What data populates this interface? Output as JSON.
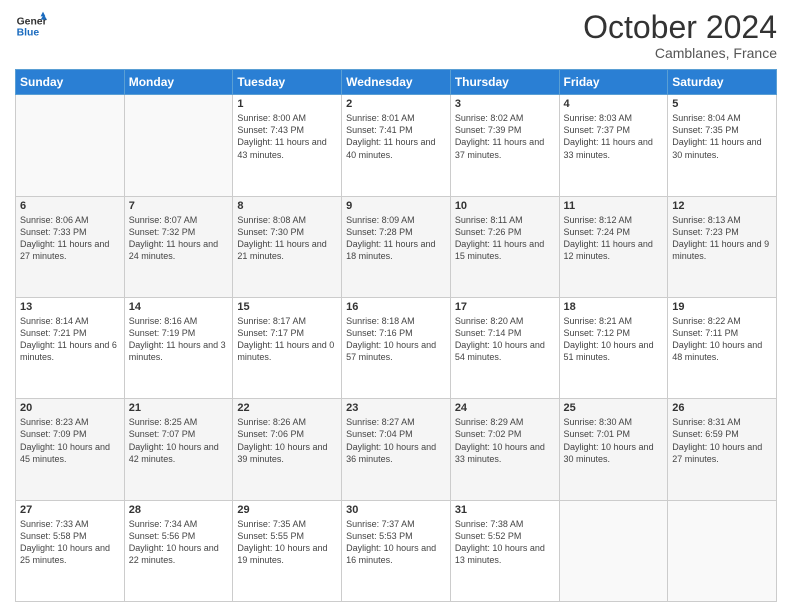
{
  "header": {
    "logo_line1": "General",
    "logo_line2": "Blue",
    "month": "October 2024",
    "location": "Camblanes, France"
  },
  "weekdays": [
    "Sunday",
    "Monday",
    "Tuesday",
    "Wednesday",
    "Thursday",
    "Friday",
    "Saturday"
  ],
  "weeks": [
    [
      {
        "day": "",
        "info": ""
      },
      {
        "day": "",
        "info": ""
      },
      {
        "day": "1",
        "info": "Sunrise: 8:00 AM\nSunset: 7:43 PM\nDaylight: 11 hours and 43 minutes."
      },
      {
        "day": "2",
        "info": "Sunrise: 8:01 AM\nSunset: 7:41 PM\nDaylight: 11 hours and 40 minutes."
      },
      {
        "day": "3",
        "info": "Sunrise: 8:02 AM\nSunset: 7:39 PM\nDaylight: 11 hours and 37 minutes."
      },
      {
        "day": "4",
        "info": "Sunrise: 8:03 AM\nSunset: 7:37 PM\nDaylight: 11 hours and 33 minutes."
      },
      {
        "day": "5",
        "info": "Sunrise: 8:04 AM\nSunset: 7:35 PM\nDaylight: 11 hours and 30 minutes."
      }
    ],
    [
      {
        "day": "6",
        "info": "Sunrise: 8:06 AM\nSunset: 7:33 PM\nDaylight: 11 hours and 27 minutes."
      },
      {
        "day": "7",
        "info": "Sunrise: 8:07 AM\nSunset: 7:32 PM\nDaylight: 11 hours and 24 minutes."
      },
      {
        "day": "8",
        "info": "Sunrise: 8:08 AM\nSunset: 7:30 PM\nDaylight: 11 hours and 21 minutes."
      },
      {
        "day": "9",
        "info": "Sunrise: 8:09 AM\nSunset: 7:28 PM\nDaylight: 11 hours and 18 minutes."
      },
      {
        "day": "10",
        "info": "Sunrise: 8:11 AM\nSunset: 7:26 PM\nDaylight: 11 hours and 15 minutes."
      },
      {
        "day": "11",
        "info": "Sunrise: 8:12 AM\nSunset: 7:24 PM\nDaylight: 11 hours and 12 minutes."
      },
      {
        "day": "12",
        "info": "Sunrise: 8:13 AM\nSunset: 7:23 PM\nDaylight: 11 hours and 9 minutes."
      }
    ],
    [
      {
        "day": "13",
        "info": "Sunrise: 8:14 AM\nSunset: 7:21 PM\nDaylight: 11 hours and 6 minutes."
      },
      {
        "day": "14",
        "info": "Sunrise: 8:16 AM\nSunset: 7:19 PM\nDaylight: 11 hours and 3 minutes."
      },
      {
        "day": "15",
        "info": "Sunrise: 8:17 AM\nSunset: 7:17 PM\nDaylight: 11 hours and 0 minutes."
      },
      {
        "day": "16",
        "info": "Sunrise: 8:18 AM\nSunset: 7:16 PM\nDaylight: 10 hours and 57 minutes."
      },
      {
        "day": "17",
        "info": "Sunrise: 8:20 AM\nSunset: 7:14 PM\nDaylight: 10 hours and 54 minutes."
      },
      {
        "day": "18",
        "info": "Sunrise: 8:21 AM\nSunset: 7:12 PM\nDaylight: 10 hours and 51 minutes."
      },
      {
        "day": "19",
        "info": "Sunrise: 8:22 AM\nSunset: 7:11 PM\nDaylight: 10 hours and 48 minutes."
      }
    ],
    [
      {
        "day": "20",
        "info": "Sunrise: 8:23 AM\nSunset: 7:09 PM\nDaylight: 10 hours and 45 minutes."
      },
      {
        "day": "21",
        "info": "Sunrise: 8:25 AM\nSunset: 7:07 PM\nDaylight: 10 hours and 42 minutes."
      },
      {
        "day": "22",
        "info": "Sunrise: 8:26 AM\nSunset: 7:06 PM\nDaylight: 10 hours and 39 minutes."
      },
      {
        "day": "23",
        "info": "Sunrise: 8:27 AM\nSunset: 7:04 PM\nDaylight: 10 hours and 36 minutes."
      },
      {
        "day": "24",
        "info": "Sunrise: 8:29 AM\nSunset: 7:02 PM\nDaylight: 10 hours and 33 minutes."
      },
      {
        "day": "25",
        "info": "Sunrise: 8:30 AM\nSunset: 7:01 PM\nDaylight: 10 hours and 30 minutes."
      },
      {
        "day": "26",
        "info": "Sunrise: 8:31 AM\nSunset: 6:59 PM\nDaylight: 10 hours and 27 minutes."
      }
    ],
    [
      {
        "day": "27",
        "info": "Sunrise: 7:33 AM\nSunset: 5:58 PM\nDaylight: 10 hours and 25 minutes."
      },
      {
        "day": "28",
        "info": "Sunrise: 7:34 AM\nSunset: 5:56 PM\nDaylight: 10 hours and 22 minutes."
      },
      {
        "day": "29",
        "info": "Sunrise: 7:35 AM\nSunset: 5:55 PM\nDaylight: 10 hours and 19 minutes."
      },
      {
        "day": "30",
        "info": "Sunrise: 7:37 AM\nSunset: 5:53 PM\nDaylight: 10 hours and 16 minutes."
      },
      {
        "day": "31",
        "info": "Sunrise: 7:38 AM\nSunset: 5:52 PM\nDaylight: 10 hours and 13 minutes."
      },
      {
        "day": "",
        "info": ""
      },
      {
        "day": "",
        "info": ""
      }
    ]
  ]
}
